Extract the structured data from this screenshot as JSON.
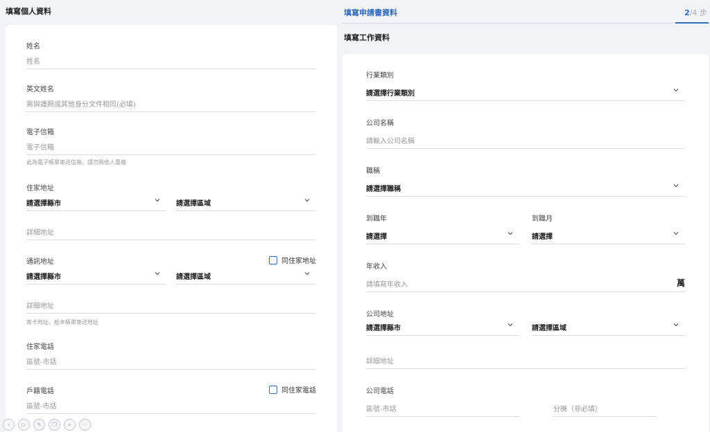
{
  "left": {
    "title": "填寫個人資料",
    "name": {
      "label": "姓名",
      "placeholder": "姓名"
    },
    "english_name": {
      "label": "英文姓名",
      "placeholder": "需與護照或其他身分文件相同(必填)"
    },
    "email": {
      "label": "電子信箱",
      "placeholder": "電子信箱",
      "hint": "此為電子帳單寄送信箱，請勿與他人重複"
    },
    "home_address": {
      "label": "住家地址",
      "city": "請選擇縣市",
      "district": "請選擇區域",
      "detail_placeholder": "詳細地址"
    },
    "mail_address": {
      "label": "通訊地址",
      "same_label": "同住家地址",
      "city": "請選擇縣市",
      "district": "請選擇區域",
      "detail_placeholder": "詳細地址",
      "hint": "寄卡地址、紙本帳單寄送地址"
    },
    "home_phone": {
      "label": "住家電話",
      "placeholder": "區號-市話"
    },
    "registered_phone": {
      "label": "戶籍電話",
      "same_label": "同住家電話",
      "placeholder": "區號-市話"
    }
  },
  "header": {
    "title": "填寫申請書資料",
    "step_current": "2",
    "step_total": "/4 步"
  },
  "right": {
    "subtitle": "填寫工作資料",
    "industry": {
      "label": "行業類別",
      "value": "請選擇行業類別"
    },
    "company": {
      "label": "公司名稱",
      "placeholder": "請輸入公司名稱"
    },
    "title_field": {
      "label": "職稱",
      "value": "請選擇職稱"
    },
    "start_year": {
      "label": "到職年",
      "value": "請選擇"
    },
    "start_month": {
      "label": "到職月",
      "value": "請選擇"
    },
    "income": {
      "label": "年收入",
      "placeholder": "請填寫年收入",
      "unit": "萬"
    },
    "company_address": {
      "label": "公司地址",
      "city": "請選擇縣市",
      "district": "請選擇區域",
      "detail_placeholder": "詳細地址"
    },
    "company_phone": {
      "label": "公司電話",
      "placeholder": "區號-市話",
      "ext_placeholder": "分機（非必填）"
    }
  },
  "icons": [
    "chevron-left-icon",
    "play-icon",
    "edit-icon",
    "copy-icon",
    "zoom-icon",
    "more-icon"
  ]
}
